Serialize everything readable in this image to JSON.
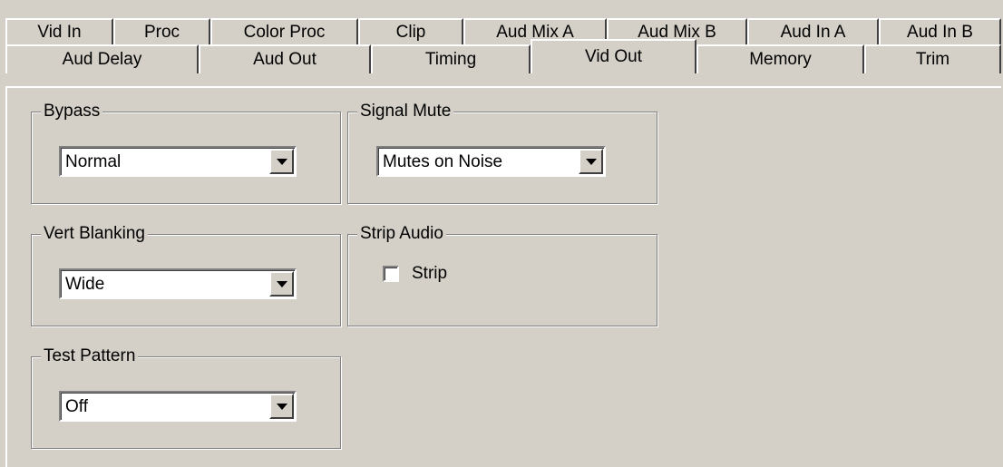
{
  "tabs_row1": [
    "Vid In",
    "Proc",
    "Color Proc",
    "Clip",
    "Aud Mix A",
    "Aud Mix B",
    "Aud In A",
    "Aud In B"
  ],
  "tabs_row2": [
    "Aud Delay",
    "Aud Out",
    "Timing",
    "Vid Out",
    "Memory",
    "Trim"
  ],
  "active_tab": "Vid Out",
  "groups": {
    "bypass": {
      "label": "Bypass",
      "value": "Normal"
    },
    "signal_mute": {
      "label": "Signal Mute",
      "value": "Mutes on Noise"
    },
    "vert_blanking": {
      "label": "Vert Blanking",
      "value": "Wide"
    },
    "strip_audio": {
      "label": "Strip Audio",
      "checkbox_label": "Strip",
      "checked": false
    },
    "test_pattern": {
      "label": "Test Pattern",
      "value": "Off"
    }
  },
  "icons": {
    "dropdown": "chevron-down-icon"
  }
}
